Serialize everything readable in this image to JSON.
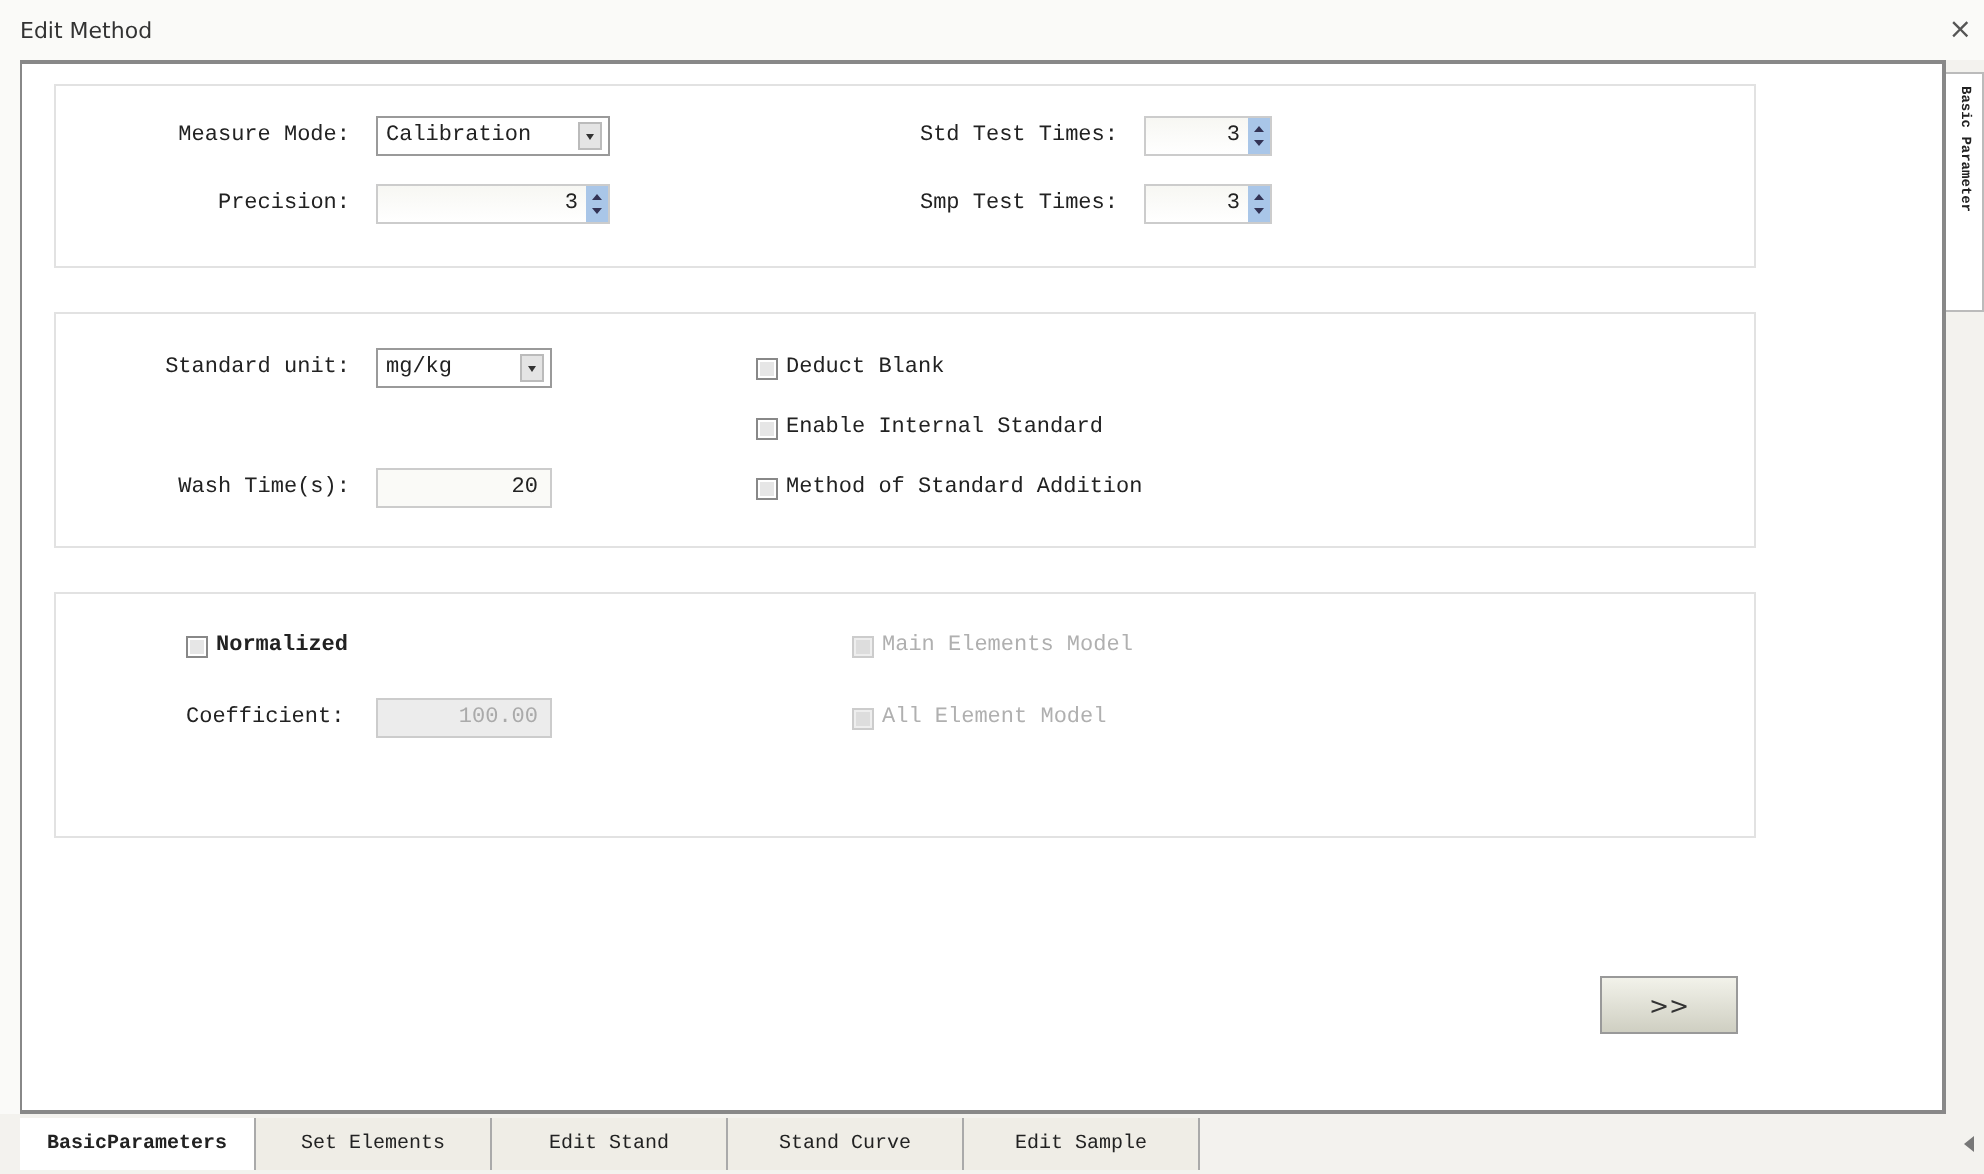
{
  "window": {
    "title": "Edit Method",
    "close": "×"
  },
  "side_tab": {
    "label": "Basic Parameter",
    "selected": true
  },
  "sections": [
    {
      "kind": "mode",
      "left": [
        {
          "kind": "select",
          "label": "Measure Mode:",
          "value": "Calibration"
        },
        {
          "kind": "spin",
          "label": "Precision:",
          "value": "3"
        }
      ],
      "right": [
        {
          "kind": "spin",
          "label": "Std Test Times:",
          "value": "3"
        },
        {
          "kind": "spin",
          "label": "Smp Test Times:",
          "value": "3"
        }
      ]
    },
    {
      "kind": "unit",
      "left": [
        {
          "kind": "select",
          "label": "Standard unit:",
          "value": "mg/kg"
        },
        {
          "kind": "text",
          "label": "Wash Time(s):",
          "value": "20",
          "disabled": false
        }
      ],
      "right": [
        {
          "kind": "checkbox",
          "label": "Deduct Blank",
          "checked": false,
          "disabled": false
        },
        {
          "kind": "checkbox",
          "label": "Enable Internal Standard",
          "checked": false,
          "disabled": false
        },
        {
          "kind": "checkbox",
          "label": "Method of Standard Addition",
          "checked": false,
          "disabled": false
        }
      ]
    },
    {
      "kind": "normalize",
      "left": [
        {
          "kind": "checkbox",
          "label": "Normalized",
          "checked": false,
          "disabled": false
        },
        {
          "kind": "text",
          "label": "Coefficient:",
          "value": "100.00",
          "disabled": true
        }
      ],
      "right": [
        {
          "kind": "checkbox",
          "label": "Main Elements Model",
          "checked": false,
          "disabled": true
        },
        {
          "kind": "checkbox",
          "label": "All Element Model",
          "checked": false,
          "disabled": true
        }
      ]
    }
  ],
  "next_button": ">>",
  "tabs": [
    {
      "label": "BasicParameters",
      "selected": true
    },
    {
      "label": "Set Elements",
      "selected": false
    },
    {
      "label": "Edit Stand",
      "selected": false
    },
    {
      "label": "Stand Curve",
      "selected": false
    },
    {
      "label": "Edit Sample",
      "selected": false
    }
  ]
}
